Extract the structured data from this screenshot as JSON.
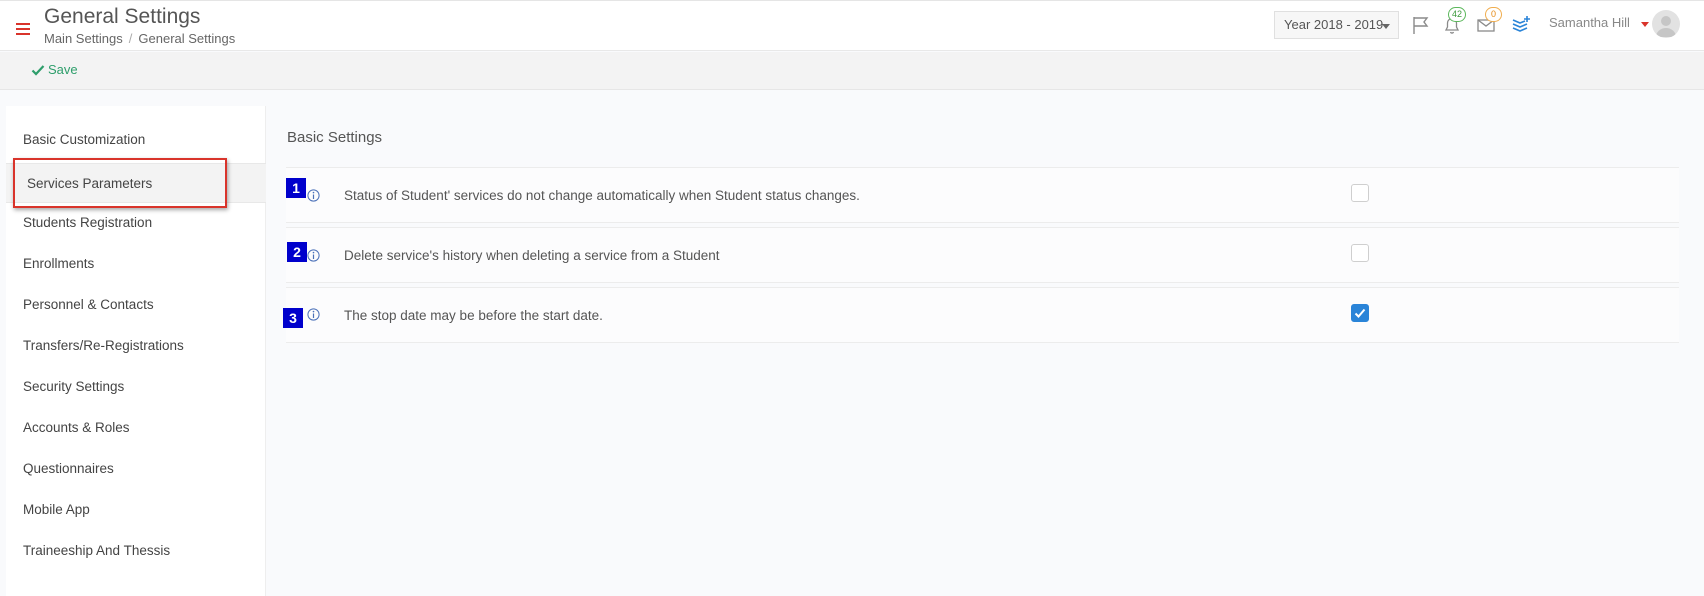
{
  "header": {
    "title": "General Settings",
    "breadcrumb": [
      "Main Settings",
      "General Settings"
    ],
    "breadcrumb_separator": "/",
    "year_select": "Year 2018 - 2019",
    "notifications_count": "42",
    "messages_count": "0",
    "user_name": "Samantha Hill"
  },
  "toolbar": {
    "save_label": "Save"
  },
  "sidebar": {
    "items": [
      {
        "label": "Basic Customization"
      },
      {
        "label": "Services Parameters",
        "active": true
      },
      {
        "label": "Students Registration"
      },
      {
        "label": "Enrollments"
      },
      {
        "label": "Personnel & Contacts"
      },
      {
        "label": "Transfers/Re-Registrations"
      },
      {
        "label": "Security Settings"
      },
      {
        "label": "Accounts & Roles"
      },
      {
        "label": "Questionnaires"
      },
      {
        "label": "Mobile App"
      },
      {
        "label": "Traineeship And Thessis"
      }
    ]
  },
  "main": {
    "section_title": "Basic Settings",
    "settings": [
      {
        "number": "1",
        "label": "Status of Student' services do not change automatically when Student status changes.",
        "checked": false
      },
      {
        "number": "2",
        "label": "Delete service's history when deleting a service from a Student",
        "checked": false
      },
      {
        "number": "3",
        "label": "The stop date may be before the start date.",
        "checked": true
      }
    ]
  },
  "colors": {
    "accent_red": "#d9342b",
    "save_green": "#2e9e6b",
    "number_badge_blue": "#0000cc",
    "checkbox_blue": "#2a84d8"
  }
}
